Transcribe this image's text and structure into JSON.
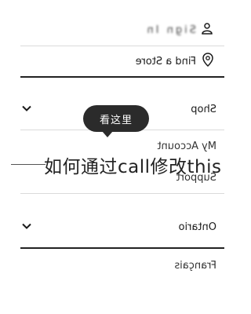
{
  "menu": {
    "account_blurred_label": "Sign In",
    "find_store_label": "Find a Store",
    "shop_label": "Shop",
    "my_account_label": "My Account",
    "support_label": "Support",
    "region_label": "Ontario",
    "language_label": "Français"
  },
  "overlay": {
    "bubble_text": "看这里",
    "caption_text": "如何通过call修改this"
  },
  "icons": [
    "person-icon",
    "location-pin-icon",
    "chevron-down-icon"
  ]
}
